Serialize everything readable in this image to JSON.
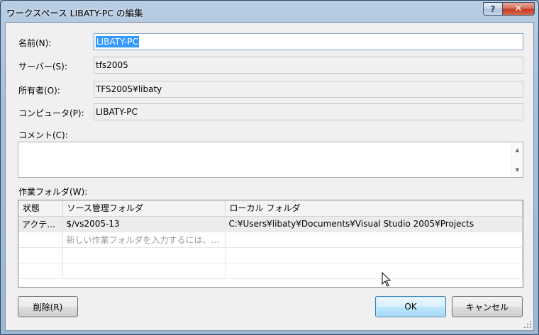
{
  "window": {
    "title": "ワークスペース LIBATY-PC の編集",
    "help_label": "?",
    "close_label": "✕"
  },
  "form": {
    "name_label": "名前(N):",
    "name_value": "LIBATY-PC",
    "server_label": "サーバー(S):",
    "server_value": "tfs2005",
    "owner_label": "所有者(O):",
    "owner_value": "TFS2005¥libaty",
    "computer_label": "コンピュータ(P):",
    "computer_value": "LIBATY-PC",
    "comment_label": "コメント(C):",
    "comment_value": ""
  },
  "folders": {
    "label": "作業フォルダ(W):",
    "columns": [
      "状態",
      "ソース管理フォルダ",
      "ローカル フォルダ"
    ],
    "rows": [
      [
        "アクテ...",
        "$/vs2005-13",
        "C:¥Users¥libaty¥Documents¥Visual Studio 2005¥Projects"
      ]
    ],
    "placeholder": "新しい作業フォルダを入力するには、..."
  },
  "buttons": {
    "delete_label": "削除(R)",
    "ok_label": "OK",
    "cancel_label": "キャンセル"
  },
  "icons": {
    "help": "help-icon",
    "close": "close-icon",
    "scroll_up": "scroll-up-arrow-icon",
    "scroll_down": "scroll-down-arrow-icon",
    "cursor": "mouse-pointer-icon",
    "grip": "resize-grip-icon"
  },
  "colors": {
    "selection": "#3399ff",
    "close_button": "#c0391f",
    "default_button_border": "#3c7fb1"
  }
}
